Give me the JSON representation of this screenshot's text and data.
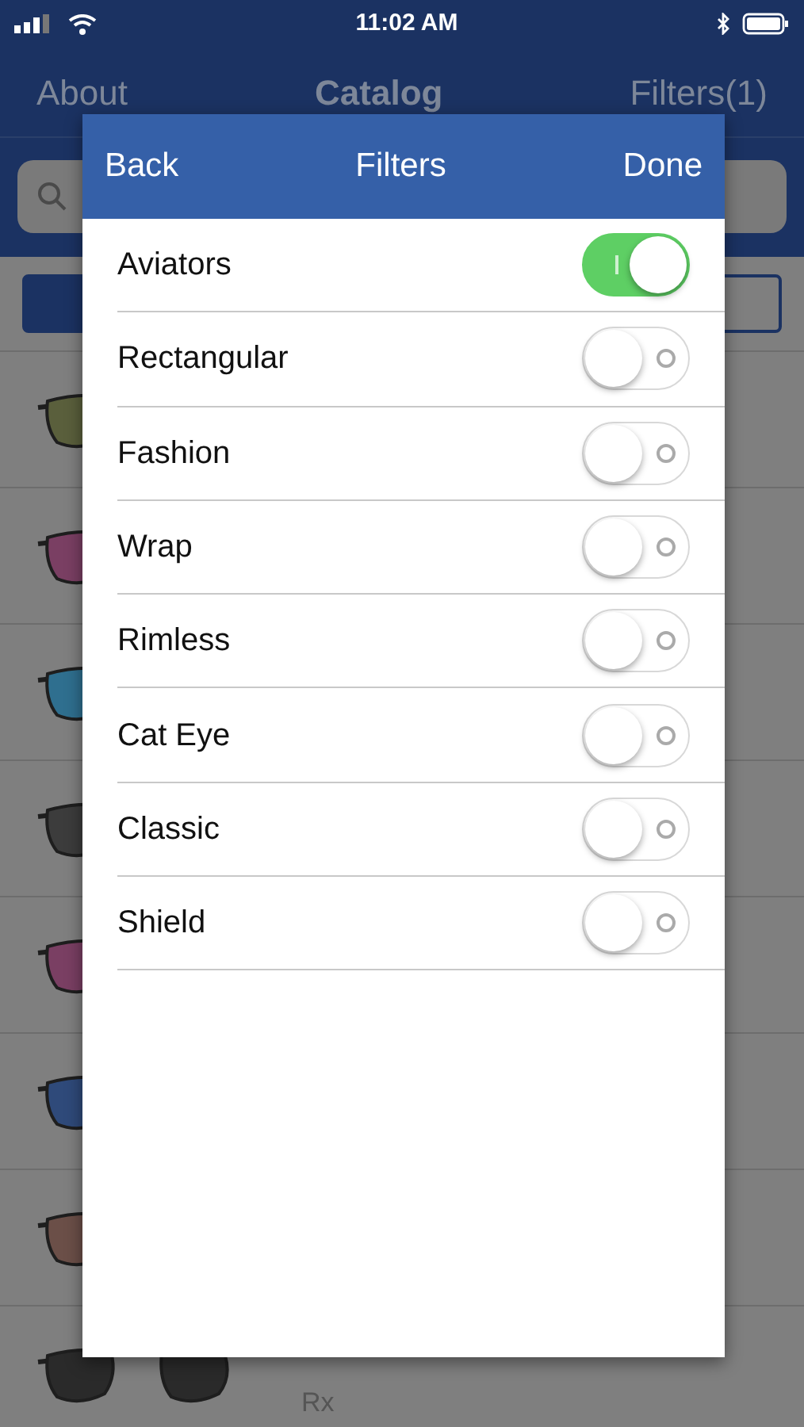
{
  "status_bar": {
    "time": "11:02 AM"
  },
  "nav_bar": {
    "left": "About",
    "title": "Catalog",
    "right": "Filters(1)"
  },
  "segments": [
    {
      "selected": true
    },
    {
      "selected": false
    }
  ],
  "catalog_rows": [
    {
      "kind": "picture"
    },
    {
      "kind": "picture"
    },
    {
      "kind": "picture"
    },
    {
      "kind": "picture"
    },
    {
      "kind": "picture"
    },
    {
      "kind": "picture"
    },
    {
      "kind": "picture"
    },
    {
      "kind": "picture",
      "caption": "Rx"
    }
  ],
  "dialog": {
    "back": "Back",
    "title": "Filters",
    "done": "Done",
    "filters": [
      {
        "label": "Aviators",
        "on": true
      },
      {
        "label": "Rectangular",
        "on": false
      },
      {
        "label": "Fashion",
        "on": false
      },
      {
        "label": "Wrap",
        "on": false
      },
      {
        "label": "Rimless",
        "on": false
      },
      {
        "label": "Cat Eye",
        "on": false
      },
      {
        "label": "Classic",
        "on": false
      },
      {
        "label": "Shield",
        "on": false
      }
    ]
  }
}
